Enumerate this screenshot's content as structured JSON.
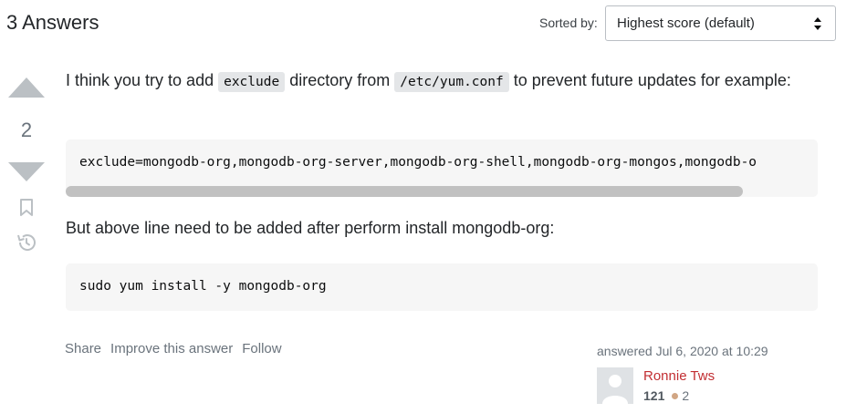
{
  "header": {
    "answers_title": "3 Answers",
    "sort_label": "Sorted by:",
    "sort_selected": "Highest score (default)"
  },
  "votes": {
    "count": "2"
  },
  "post": {
    "para1_before": "I think you try to add ",
    "para1_code1": "exclude",
    "para1_mid": " directory from ",
    "para1_code2": "/etc/yum.conf",
    "para1_after": " to prevent future updates for example:",
    "code_block1": "exclude=mongodb-org,mongodb-org-server,mongodb-org-shell,mongodb-org-mongos,mongodb-o",
    "para2": "But above line need to be added after perform install mongodb-org:",
    "code_block2": "sudo yum install -y mongodb-org"
  },
  "post_menu": {
    "share": "Share",
    "improve": "Improve this answer",
    "follow": "Follow"
  },
  "signature": {
    "action": "answered Jul 6, 2020 at 10:29",
    "user_name": "Ronnie Tws",
    "reputation": "121",
    "bronze_badges": "2"
  },
  "icons": {
    "vote_up": "triangle-up-icon",
    "vote_down": "triangle-down-icon",
    "bookmark": "bookmark-icon",
    "history": "history-icon",
    "select_chevron": "chevron-up-down-icon"
  },
  "colors": {
    "username": "#c22e32",
    "vote_arrow": "#bbc0c4",
    "bronze_badge": "#d1a684"
  }
}
